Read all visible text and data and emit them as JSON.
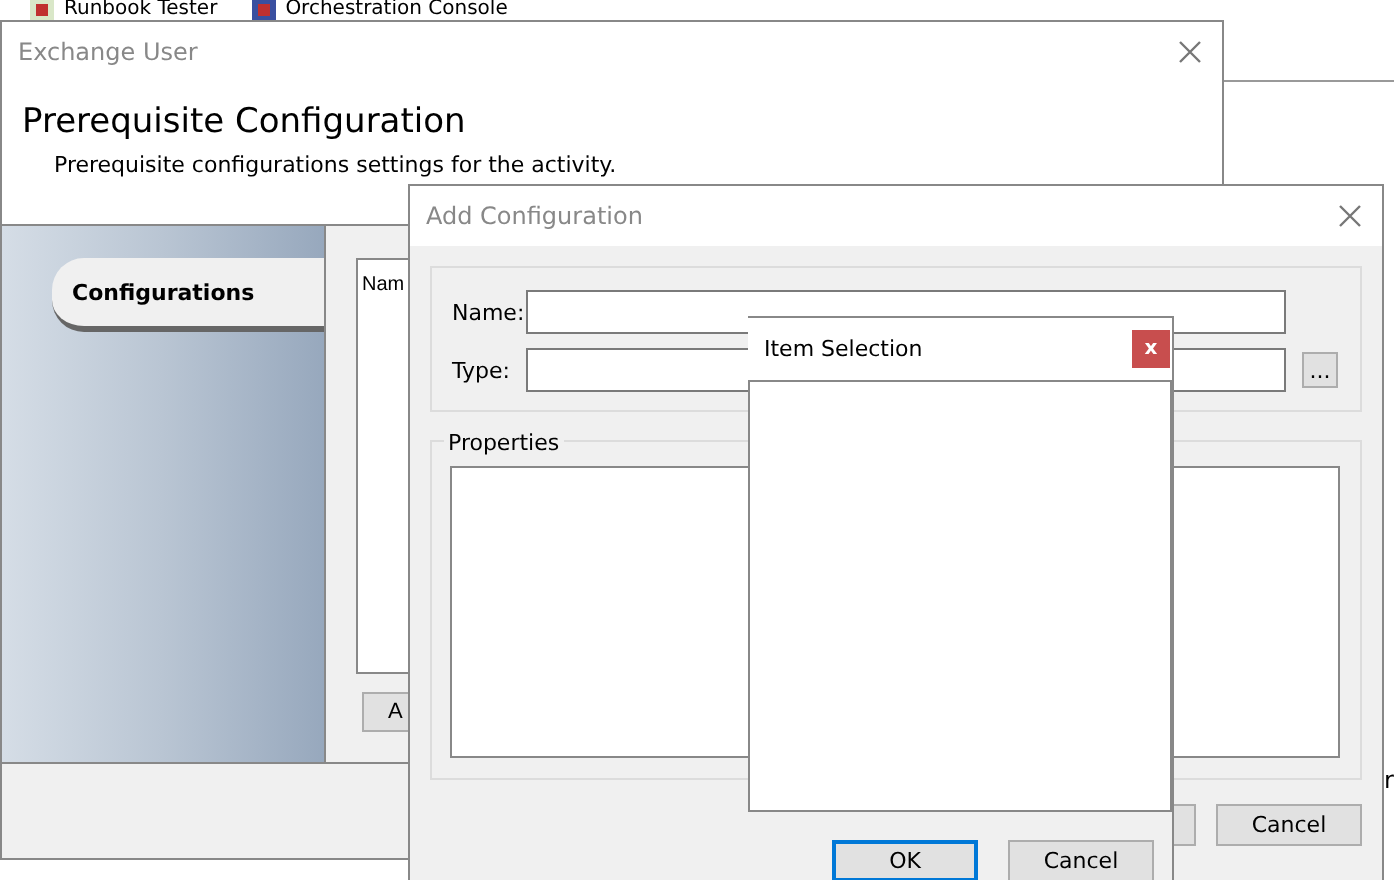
{
  "taskbar": {
    "items": [
      {
        "label": "Runbook Tester"
      },
      {
        "label": "Orchestration Console"
      }
    ]
  },
  "main_window": {
    "title": "Exchange User",
    "heading": "Prerequisite Configuration",
    "subtitle": "Prerequisite configurations settings for the activity.",
    "tabs": [
      {
        "label": "Configurations",
        "selected": true
      }
    ],
    "list_header": "Nam",
    "button": "A"
  },
  "background_window": {
    "text": "r"
  },
  "add_configuration": {
    "title": "Add Configuration",
    "fields": [
      {
        "label": "Name:",
        "kind": "text"
      },
      {
        "label": "Type:",
        "kind": "browse",
        "browse_label": "..."
      }
    ],
    "properties_label": "Properties",
    "buttons": [
      "Cancel"
    ]
  },
  "item_selection": {
    "title": "Item Selection",
    "close_label": "x",
    "buttons": [
      {
        "label": "OK",
        "focused": true
      },
      {
        "label": "Cancel",
        "focused": false
      }
    ]
  }
}
